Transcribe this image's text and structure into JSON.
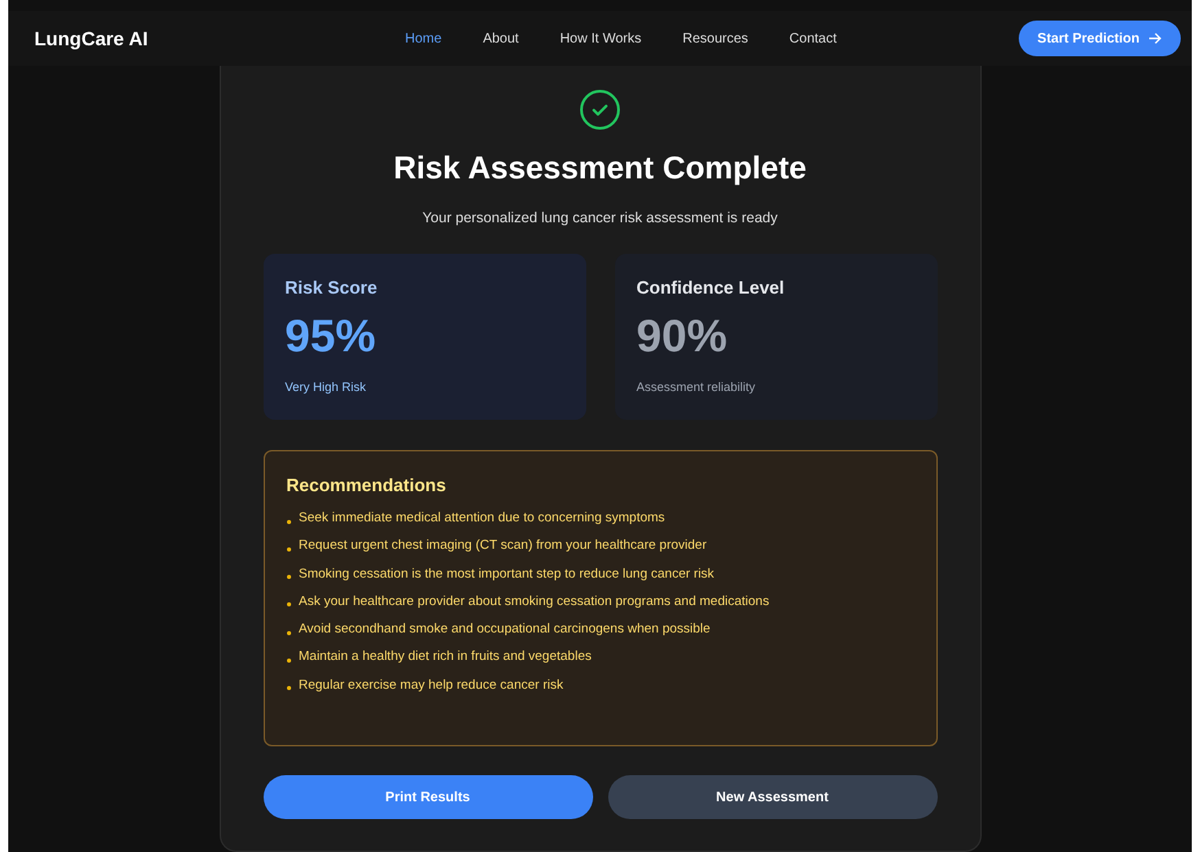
{
  "nav": {
    "brand": "LungCare AI",
    "links": [
      {
        "label": "Home",
        "selected": true
      },
      {
        "label": "About",
        "selected": false
      },
      {
        "label": "How It Works",
        "selected": false
      },
      {
        "label": "Resources",
        "selected": false
      },
      {
        "label": "Contact",
        "selected": false
      }
    ],
    "cta": "Start Prediction"
  },
  "result": {
    "title": "Risk Assessment Complete",
    "subtitle": "Your personalized lung cancer risk assessment is ready",
    "metrics": [
      {
        "kind": "risk",
        "label": "Risk Score",
        "value": "95%",
        "caption": "Very High Risk"
      },
      {
        "kind": "confidence",
        "label": "Confidence Level",
        "value": "90%",
        "caption": "Assessment reliability"
      }
    ],
    "recommendations": {
      "title": "Recommendations",
      "items": [
        "Seek immediate medical attention due to concerning symptoms",
        "Request urgent chest imaging (CT scan) from your healthcare provider",
        "Smoking cessation is the most important step to reduce lung cancer risk",
        "Ask your healthcare provider about smoking cessation programs and medications",
        "Avoid secondhand smoke and occupational carcinogens when possible",
        "Maintain a healthy diet rich in fruits and vegetables",
        "Regular exercise may help reduce cancer risk"
      ]
    },
    "buttons": [
      {
        "kind": "primary",
        "label": "Print Results"
      },
      {
        "kind": "secondary",
        "label": "New Assessment"
      }
    ]
  }
}
